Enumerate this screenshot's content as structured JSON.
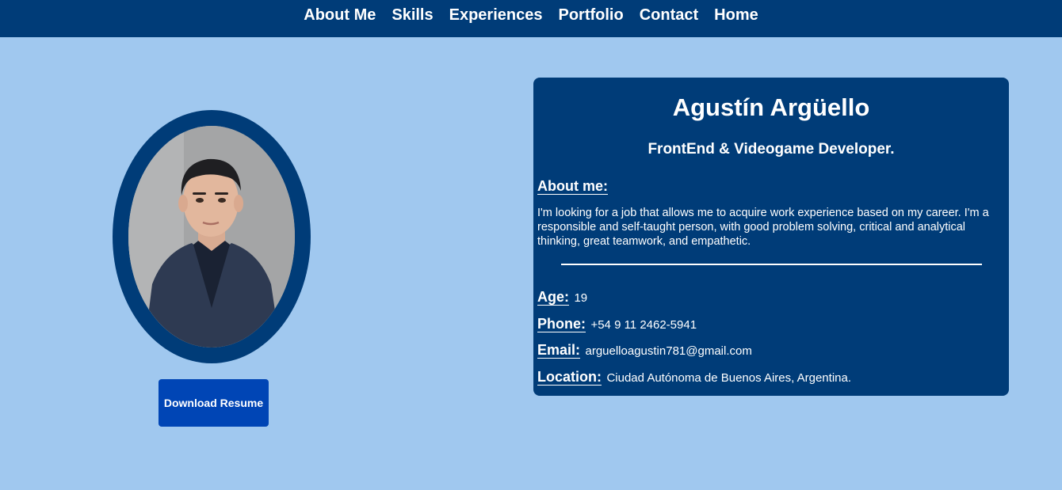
{
  "nav": {
    "items": [
      {
        "label": "About Me"
      },
      {
        "label": "Skills"
      },
      {
        "label": "Experiences"
      },
      {
        "label": "Portfolio"
      },
      {
        "label": "Contact"
      },
      {
        "label": "Home"
      }
    ]
  },
  "profile": {
    "photo_icon": "profile-photo",
    "download_label": "Download Resume"
  },
  "card": {
    "name": "Agustín Argüello",
    "role": "FrontEnd & Videogame Developer.",
    "about_label": "About me:",
    "about_text": "I'm looking for a job that allows me to acquire work experience based on my career. I'm a responsible and self-taught person, with good problem solving, critical and analytical thinking, great teamwork, and empathetic.",
    "age_label": "Age:",
    "age_value": "19",
    "phone_label": "Phone:",
    "phone_value": "+54 9 11 2462-5941",
    "email_label": "Email:",
    "email_value": "arguelloagustin781@gmail.com",
    "location_label": "Location:",
    "location_value": "Ciudad Autónoma de Buenos Aires, Argentina."
  },
  "colors": {
    "background": "#a0c8ef",
    "navbar": "#003c78",
    "card": "#003c78",
    "button": "#0045b5",
    "text": "#ffffff"
  }
}
